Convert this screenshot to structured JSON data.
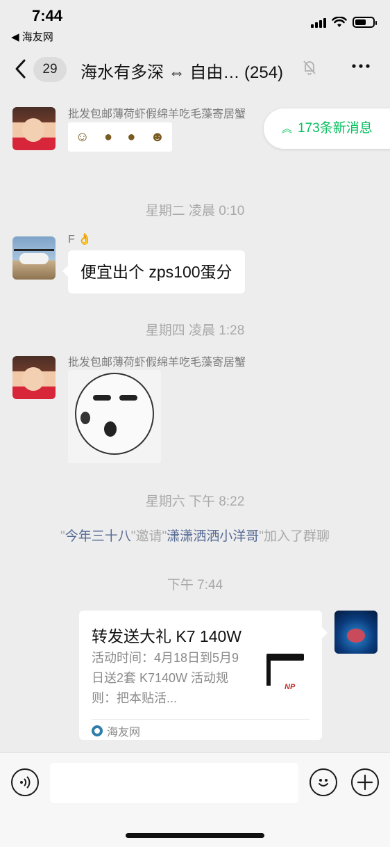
{
  "status_bar": {
    "time": "7:44",
    "back_app": "◀ 海友网"
  },
  "nav": {
    "back_icon": "chevron-left",
    "unread_count": "29",
    "title": "海水有多深 ⇔ 自由… (254)",
    "mute_icon": "bell-slash",
    "more_icon": "ellipsis"
  },
  "new_messages": {
    "label": "173条新消息",
    "icon": "double-chevron-up",
    "color": "#07c160"
  },
  "messages": {
    "msg1": {
      "sender": "批发包邮薄荷虾假绵羊吃毛藻寄居蟹",
      "type": "sticker"
    },
    "time_sep1": "星期二 凌晨 0:10",
    "msg2": {
      "sender": "F 👌",
      "text": "便宜出个 zps100蛋分"
    },
    "time_sep2": "星期四 凌晨 1:28",
    "msg3": {
      "sender": "批发包邮薄荷虾假绵羊吃毛藻寄居蟹",
      "type": "sticker"
    },
    "time_sep3": "星期六 下午 8:22",
    "system": {
      "q1": "\"",
      "inviter": "今年三十八",
      "q2": "\"邀请\"",
      "invitee": "潇潇洒洒小洋哥",
      "q3": "\"加入了群聊"
    },
    "time_sep4": "下午 7:44",
    "link_card": {
      "title": "转发送大礼 K7 140W",
      "desc": "活动时间：4月18日到5月9日送2套 K7140W 活动规则：把本贴活...",
      "source": "海友网"
    }
  },
  "input_bar": {
    "voice_icon": "voice",
    "emoji_icon": "smiley",
    "plus_icon": "plus"
  },
  "colors": {
    "background": "#ededed",
    "link_name": "#576b95",
    "accent_green": "#07c160"
  }
}
